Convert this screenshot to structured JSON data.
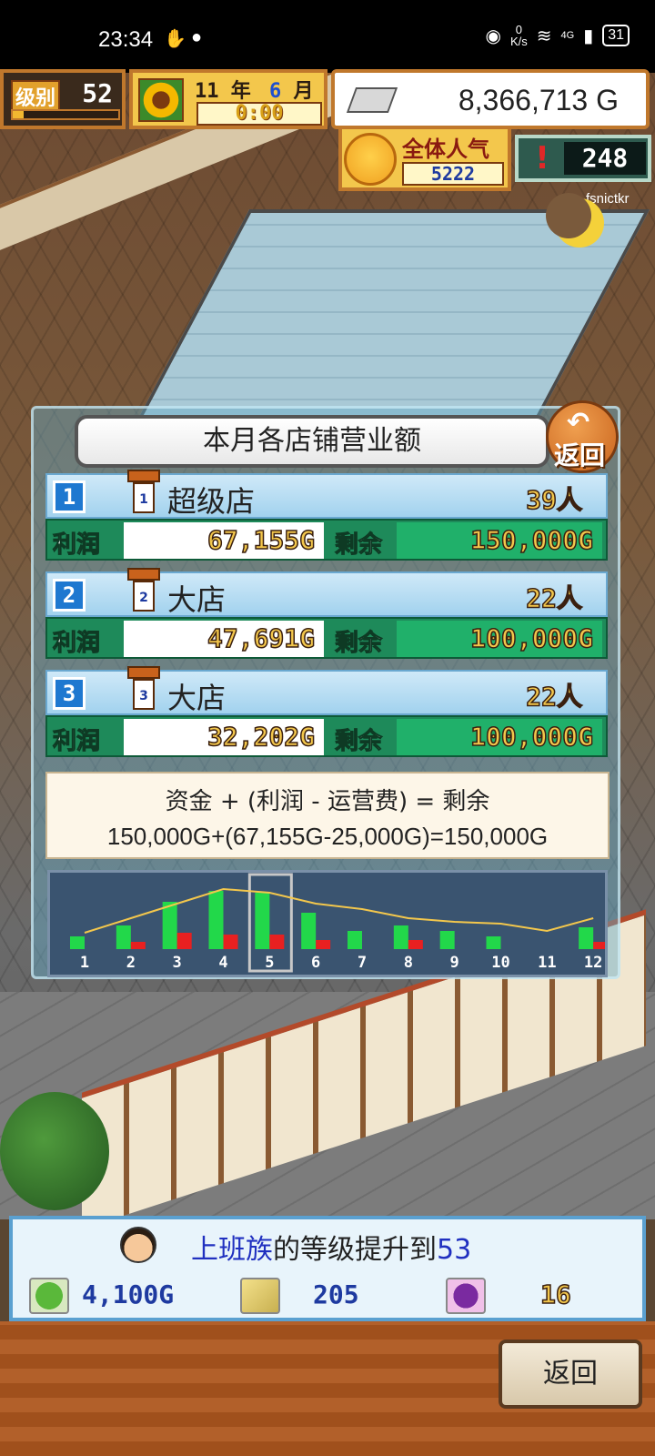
{
  "status_bar": {
    "time": "23:34",
    "net_speed_top": "0",
    "net_speed_bottom": "K/s",
    "network": "4G",
    "battery": "31"
  },
  "hud": {
    "level_label": "级别",
    "level": "52",
    "level_progress": 0.1,
    "year": "11",
    "year_unit": "年",
    "month": "6",
    "month_unit": "月",
    "clock": "0:00",
    "money": "8,366,713 G",
    "popularity_label": "全体人气",
    "popularity": "5222",
    "alert_count": "248",
    "username": "fsnictkr"
  },
  "panel": {
    "title": "本月各店铺营业额",
    "back_label": "返回",
    "profit_label": "利润",
    "remain_label": "剩余",
    "shops": [
      {
        "rank": "1",
        "icon_num": "1",
        "name": "超级店",
        "customers": "39人",
        "profit": "67,155G",
        "remain": "150,000G"
      },
      {
        "rank": "2",
        "icon_num": "2",
        "name": "大店",
        "customers": "22人",
        "profit": "47,691G",
        "remain": "100,000G"
      },
      {
        "rank": "3",
        "icon_num": "3",
        "name": "大店",
        "customers": "22人",
        "profit": "32,202G",
        "remain": "100,000G"
      }
    ],
    "formula_line1": "资金 + (利润 - 运营费) = 剩余",
    "formula_line2": "150,000G+(67,155G-25,000G)=150,000G"
  },
  "chart_data": {
    "type": "bar",
    "categories": [
      "1",
      "2",
      "3",
      "4",
      "5",
      "6",
      "7",
      "8",
      "9",
      "10",
      "11",
      "12"
    ],
    "selected": "5",
    "series": [
      {
        "values": [
          14,
          26,
          52,
          64,
          62,
          40,
          20,
          26,
          20,
          14,
          0,
          24
        ],
        "color": "#22d84a"
      },
      {
        "values": [
          0,
          8,
          18,
          16,
          16,
          10,
          0,
          10,
          0,
          0,
          0,
          8
        ],
        "color": "#e82020"
      }
    ],
    "line": [
      18,
      34,
      50,
      66,
      62,
      50,
      44,
      34,
      30,
      28,
      20,
      34
    ],
    "line_color": "#f3c74c"
  },
  "notification": {
    "name": "上班族",
    "message": "的等级提升到",
    "level": "53",
    "rewards": [
      {
        "icon": "money-bag-icon",
        "value": "4,100G",
        "color": "#1e3aa0"
      },
      {
        "icon": "spoon-icon",
        "value": "205",
        "color": "#1e3aa0"
      },
      {
        "icon": "monster-icon",
        "value": "16",
        "color": "#f3c74c"
      }
    ]
  },
  "bottom": {
    "back_label": "返回"
  }
}
